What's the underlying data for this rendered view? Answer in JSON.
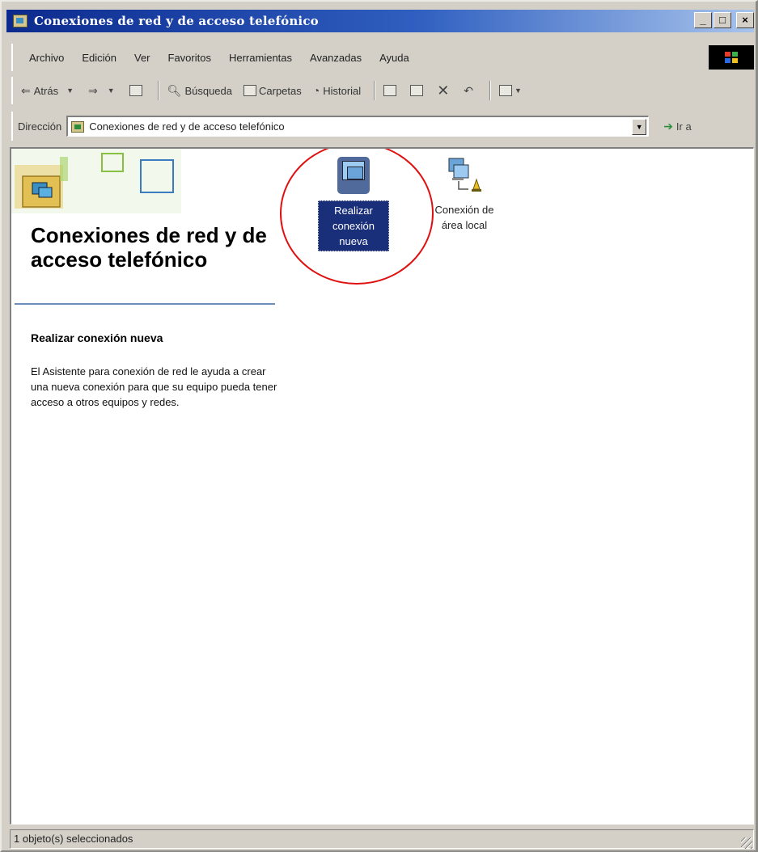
{
  "window": {
    "title": "Conexiones de red y de acceso telefónico",
    "controls": {
      "minimize": "_",
      "maximize": "□",
      "close": "×"
    }
  },
  "menu": {
    "items": [
      "Archivo",
      "Edición",
      "Ver",
      "Favoritos",
      "Herramientas",
      "Avanzadas",
      "Ayuda"
    ]
  },
  "toolbar": {
    "back": "Atrás",
    "forward": "",
    "search": "Búsqueda",
    "folders": "Carpetas",
    "history": "Historial"
  },
  "address": {
    "label": "Dirección",
    "value": "Conexiones de red y de acceso telefónico",
    "go": "Ir a"
  },
  "left_pane": {
    "title": "Conexiones de red y de acceso telefónico",
    "task_title": "Realizar conexión nueva",
    "task_description": "El Asistente para conexión de red le ayuda a crear una nueva conexión para que su equipo pueda tener acceso a otros equipos y redes."
  },
  "items": [
    {
      "label": "Realizar conexión nueva",
      "selected": true,
      "icon": "new-connection-icon"
    },
    {
      "label": "Conexión de área local",
      "selected": false,
      "icon": "lan-connection-icon"
    }
  ],
  "status": {
    "text": "1 objeto(s) seleccionados"
  },
  "colors": {
    "titlebar_start": "#0c2a8e",
    "titlebar_end": "#a8c4ec",
    "selection": "#1a2f7a",
    "highlight_circle": "#e01010"
  }
}
